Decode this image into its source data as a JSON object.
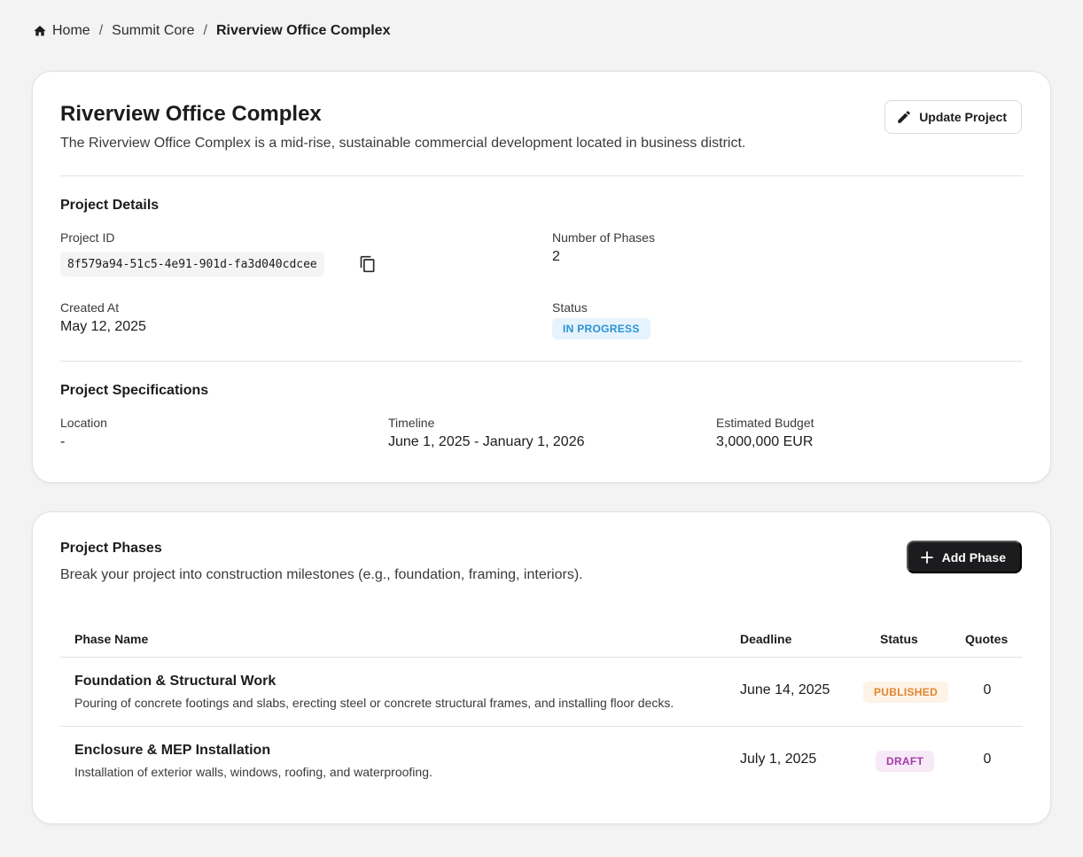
{
  "breadcrumb": {
    "home": "Home",
    "separator": "/",
    "org": "Summit Core",
    "current": "Riverview Office Complex"
  },
  "project": {
    "title": "Riverview Office Complex",
    "description": "The Riverview Office Complex is a mid-rise, sustainable commercial development located in business district.",
    "update_label": "Update Project"
  },
  "details": {
    "section_title": "Project Details",
    "id_label": "Project ID",
    "id_value": "8f579a94-51c5-4e91-901d-fa3d040cdcee",
    "phases_label": "Number of Phases",
    "phases_value": "2",
    "created_label": "Created At",
    "created_value": "May 12, 2025",
    "status_label": "Status",
    "status_value": "IN PROGRESS"
  },
  "specs": {
    "section_title": "Project Specifications",
    "location_label": "Location",
    "location_value": "-",
    "timeline_label": "Timeline",
    "timeline_value": "June 1, 2025 - January 1, 2026",
    "budget_label": "Estimated Budget",
    "budget_value": "3,000,000 EUR"
  },
  "phases": {
    "section_title": "Project Phases",
    "subtitle": "Break your project into construction milestones (e.g., foundation, framing, interiors).",
    "add_label": "Add Phase",
    "columns": {
      "name": "Phase Name",
      "deadline": "Deadline",
      "status": "Status",
      "quotes": "Quotes"
    },
    "rows": [
      {
        "name": "Foundation & Structural Work",
        "description": "Pouring of concrete footings and slabs, erecting steel or concrete structural frames, and installing floor decks.",
        "deadline": "June 14, 2025",
        "status": "PUBLISHED",
        "quotes": "0"
      },
      {
        "name": "Enclosure & MEP Installation",
        "description": "Installation of exterior walls, windows, roofing, and waterproofing.",
        "deadline": "July 1, 2025",
        "status": "DRAFT",
        "quotes": "0"
      }
    ]
  },
  "colors": {
    "accent_dark": "#1c1c1e",
    "status_in_progress": "#2a93d5",
    "status_published": "#e0852d",
    "status_draft": "#a33aa8"
  },
  "icons": [
    "home-icon",
    "pencil-icon",
    "copy-icon",
    "plus-icon"
  ]
}
